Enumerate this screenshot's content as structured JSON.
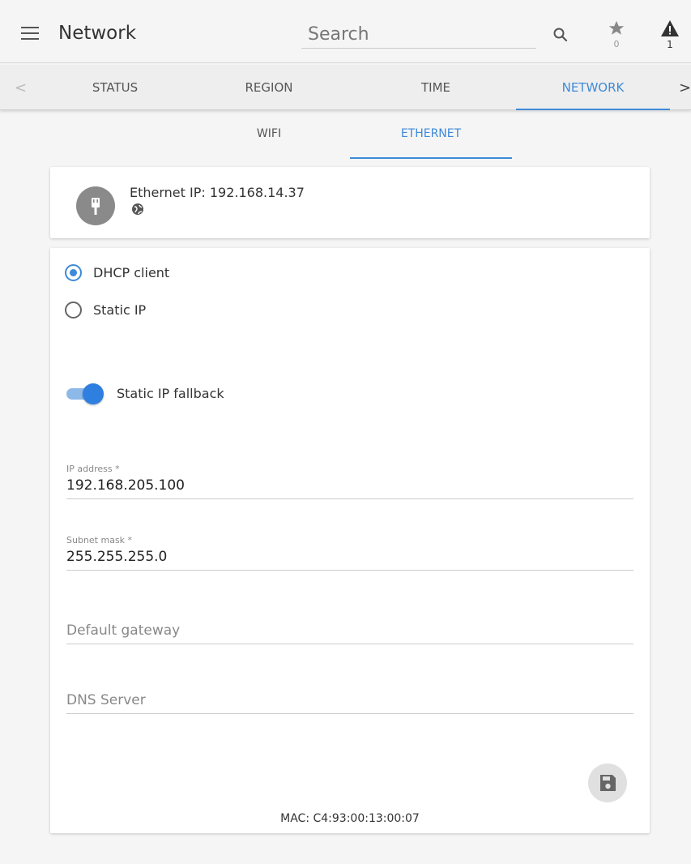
{
  "header": {
    "title": "Network",
    "search_placeholder": "Search",
    "favorites_count": "0",
    "alerts_count": "1"
  },
  "tabs": [
    {
      "label": "STATUS",
      "active": false
    },
    {
      "label": "REGION",
      "active": false
    },
    {
      "label": "TIME",
      "active": false
    },
    {
      "label": "NETWORK",
      "active": true
    }
  ],
  "subtabs": [
    {
      "label": "WIFI",
      "active": false
    },
    {
      "label": "ETHERNET",
      "active": true
    }
  ],
  "ethernet": {
    "ip_text": "Ethernet IP: 192.168.14.37"
  },
  "form": {
    "mode_options": [
      {
        "label": "DHCP client",
        "selected": true
      },
      {
        "label": "Static IP",
        "selected": false
      }
    ],
    "fallback": {
      "label": "Static IP fallback",
      "enabled": true
    },
    "ip_address": {
      "label": "IP address *",
      "value": "192.168.205.100"
    },
    "subnet_mask": {
      "label": "Subnet mask *",
      "value": "255.255.255.0"
    },
    "default_gateway": {
      "placeholder": "Default gateway",
      "value": ""
    },
    "dns_server": {
      "placeholder": "DNS Server",
      "value": ""
    },
    "mac": "MAC: C4:93:00:13:00:07"
  },
  "colors": {
    "accent": "#3f8ad8",
    "toggle_track": "#8db9e9",
    "avatar": "#8a8a8a"
  },
  "icons": {
    "menu": "menu-icon",
    "search": "search-icon",
    "favorites": "star-icon",
    "alerts": "warning-icon",
    "ethernet": "ethernet-plug-icon",
    "globe": "globe-icon",
    "save": "floppy-disk-icon"
  }
}
